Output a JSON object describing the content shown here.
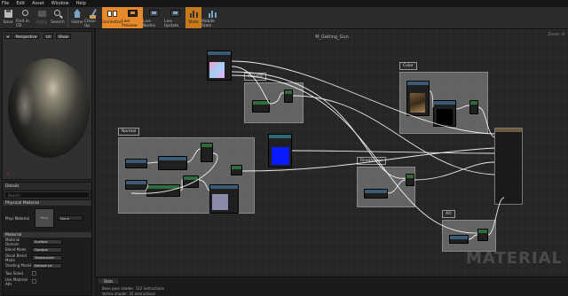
{
  "menu": [
    "File",
    "Edit",
    "Asset",
    "Window",
    "Help"
  ],
  "toolbar": [
    {
      "label": "Save",
      "icon": "save-icon"
    },
    {
      "label": "Find in CB",
      "icon": "find-in-cb-icon"
    },
    {
      "label": "Apply",
      "icon": "apply-icon"
    },
    {
      "label": "Search",
      "icon": "search-icon"
    },
    {
      "label": "Home",
      "icon": "home-icon"
    },
    {
      "label": "Clean Up",
      "icon": "clean-up-icon"
    },
    {
      "label": "Connectors",
      "icon": "connectors-icon"
    },
    {
      "label": "Live Preview",
      "icon": "live-preview-icon"
    },
    {
      "label": "Live Nodes",
      "icon": "live-nodes-icon"
    },
    {
      "label": "Live Update",
      "icon": "live-update-icon"
    },
    {
      "label": "Stats",
      "icon": "stats-icon"
    },
    {
      "label": "Mobile Stats",
      "icon": "mobile-stats-icon"
    }
  ],
  "viewport": {
    "mode": "Perspective",
    "lit": "Lit",
    "show": "Show"
  },
  "details": {
    "tab": "Details",
    "search_placeholder": "Search",
    "physical_section": "Physical Material",
    "phys_label": "Phys Material",
    "phys_value": "None",
    "material_section": "Material",
    "props": [
      {
        "label": "Material Domain",
        "value": "Surface"
      },
      {
        "label": "Blend Mode",
        "value": "Opaque"
      },
      {
        "label": "Decal Blend Mode",
        "value": "Translucent"
      },
      {
        "label": "Shading Model",
        "value": "Default Lit"
      }
    ],
    "checks": [
      {
        "label": "Two Sided"
      },
      {
        "label": "Use Material Attr"
      }
    ]
  },
  "graph": {
    "title": "M_Gatling_Gun",
    "zoom": "Zoom -4",
    "watermark": "MATERIAL",
    "comments": [
      "Normal",
      "Metallic",
      "Color",
      "Roughness",
      "AO"
    ]
  },
  "stats": {
    "tab": "Stats",
    "lines": [
      "Base pass shader: 112 instructions",
      "Vertex shader: 35 instructions"
    ]
  },
  "colors": {
    "accent": "#e5892b",
    "graph_bg": "#262626",
    "wire": "#ffffff"
  }
}
